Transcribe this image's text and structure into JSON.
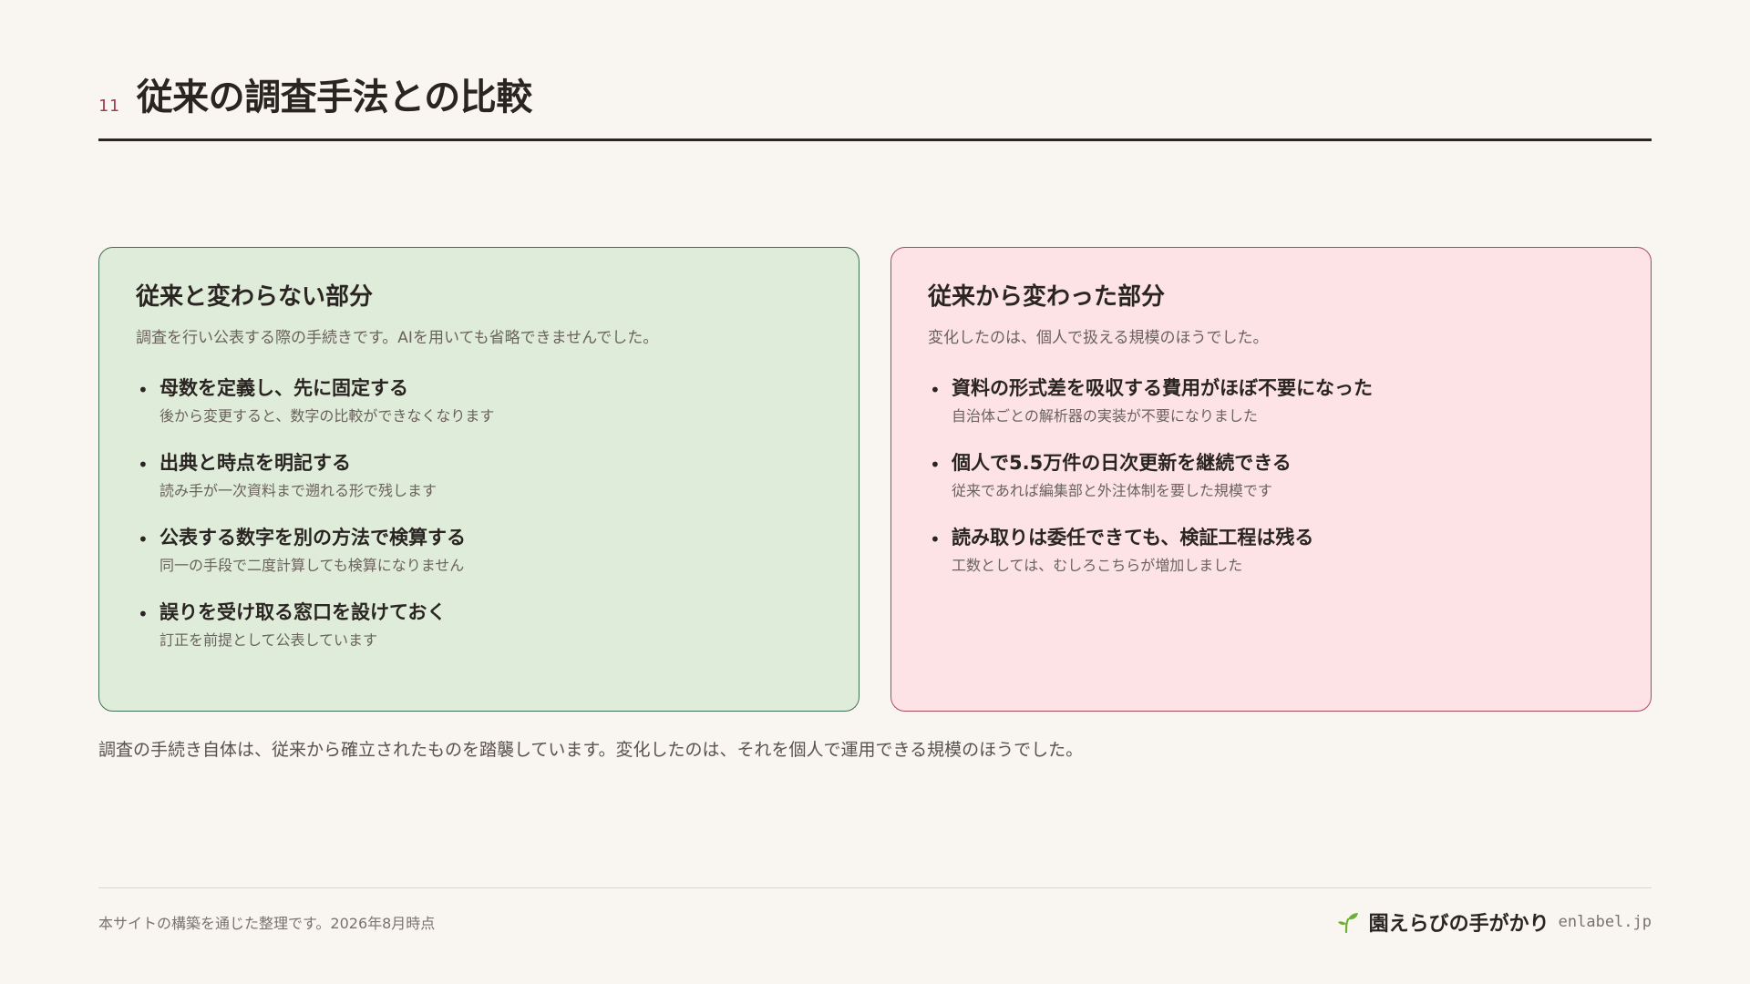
{
  "header": {
    "number": "11",
    "title": "従来の調査手法との比較"
  },
  "left_card": {
    "title": "従来と変わらない部分",
    "lead": "調査を行い公表する際の手続きです。AIを用いても省略できませんでした。",
    "items": [
      {
        "title": "母数を定義し、先に固定する",
        "sub": "後から変更すると、数字の比較ができなくなります"
      },
      {
        "title": "出典と時点を明記する",
        "sub": "読み手が一次資料まで遡れる形で残します"
      },
      {
        "title": "公表する数字を別の方法で検算する",
        "sub": "同一の手段で二度計算しても検算になりません"
      },
      {
        "title": "誤りを受け取る窓口を設けておく",
        "sub": "訂正を前提として公表しています"
      }
    ]
  },
  "right_card": {
    "title": "従来から変わった部分",
    "lead": "変化したのは、個人で扱える規模のほうでした。",
    "items": [
      {
        "title": "資料の形式差を吸収する費用がほぼ不要になった",
        "sub": "自治体ごとの解析器の実装が不要になりました"
      },
      {
        "title": "個人で5.5万件の日次更新を継続できる",
        "sub": "従来であれば編集部と外注体制を要した規模です"
      },
      {
        "title": "読み取りは委任できても、検証工程は残る",
        "sub": "工数としては、むしろこちらが増加しました"
      }
    ]
  },
  "summary": "調査の手続き自体は、従来から確立されたものを踏襲しています。変化したのは、それを個人で運用できる規模のほうでした。",
  "footer": {
    "note": "本サイトの構築を通じた整理です。2026年8月時点",
    "brand_name": "園えらびの手がかり",
    "brand_domain": "enlabel.jp",
    "brand_icon": "sprout-icon"
  },
  "colors": {
    "accent": "#a33a4c",
    "green_bg": "#dfecd9",
    "green_border": "#3f6f54",
    "pink_bg": "#fde3e5",
    "pink_border": "#a84a5c",
    "brand_green": "#6fae3a"
  }
}
